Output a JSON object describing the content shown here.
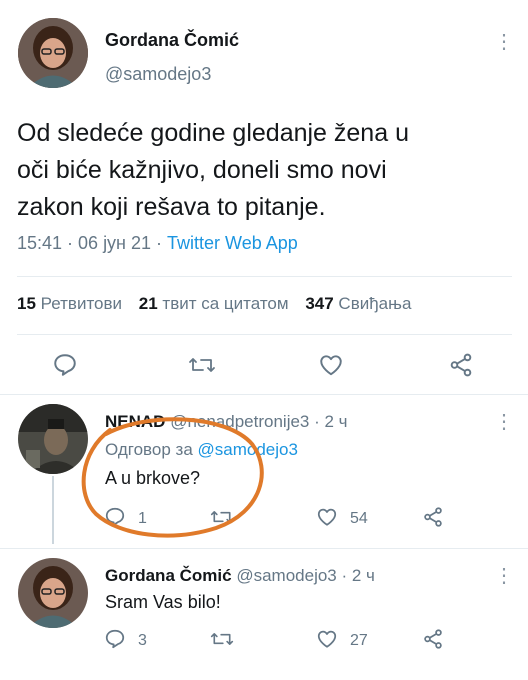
{
  "main_tweet": {
    "author_name": "Gordana Čomić",
    "handle": "@samodejo3",
    "text_line1": "Od sledeće godine gledanje žena u",
    "text_line2": "oči biće kažnjivo, doneli smo novi",
    "text_line3": "zakon koji rešava to pitanje.",
    "meta": "15:41 · 06 јун 21 · ",
    "source": "Twitter Web App",
    "stats": {
      "retweets_count": "15",
      "retweets_label": "Ретвитови",
      "quotes_count": "21",
      "quotes_label": "твит са цитатом",
      "likes_count": "347",
      "likes_label": "Свиђања"
    },
    "icons": [
      "reply-icon",
      "retweet-icon",
      "like-icon",
      "share-icon"
    ]
  },
  "replies": [
    {
      "author_name": "NENAD",
      "handle_time": "@nenadpetronije3 · 2 ч",
      "reply_to_prefix": "Одговор за ",
      "reply_to_handle": "@samodejo3",
      "text": "A u brkove?",
      "reply_count": "1",
      "retweet_count": "",
      "like_count": "54"
    },
    {
      "author_name": "Gordana Čomić",
      "handle_time": "@samodejo3 · 2 ч",
      "text": "Sram Vas bilo!",
      "reply_count": "3",
      "retweet_count": "",
      "like_count": "27"
    }
  ],
  "colors": {
    "accent": "#1b95e0",
    "muted": "#657786",
    "annotation_circle": "#e07a2a"
  }
}
